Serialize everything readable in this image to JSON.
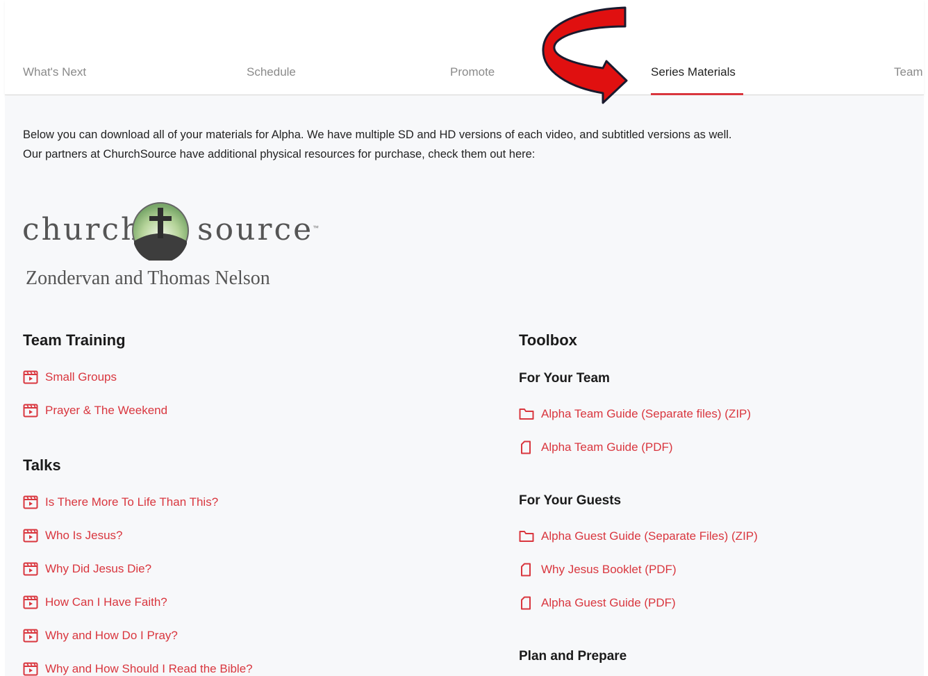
{
  "tabs": [
    {
      "label": "What's Next",
      "active": false
    },
    {
      "label": "Schedule",
      "active": false
    },
    {
      "label": "Promote",
      "active": false
    },
    {
      "label": "Series Materials",
      "active": true
    },
    {
      "label": "Team",
      "active": false
    }
  ],
  "intro": {
    "line1": "Below you can download all of your materials for Alpha. We have multiple SD and HD versions of each video, and subtitled versions as well.",
    "line2": "Our partners at ChurchSource have additional physical resources for purchase, check them out here:"
  },
  "logo": {
    "word_left": "church",
    "word_right": "source",
    "trademark": "™",
    "subtitle": "Zondervan and Thomas Nelson"
  },
  "team_training": {
    "heading": "Team Training",
    "items": [
      {
        "label": "Small Groups",
        "icon": "video-icon"
      },
      {
        "label": "Prayer & The Weekend",
        "icon": "video-icon"
      }
    ]
  },
  "talks": {
    "heading": "Talks",
    "items": [
      {
        "label": "Is There More To Life Than This?",
        "icon": "video-icon"
      },
      {
        "label": "Who Is Jesus?",
        "icon": "video-icon"
      },
      {
        "label": "Why Did Jesus Die?",
        "icon": "video-icon"
      },
      {
        "label": "How Can I Have Faith?",
        "icon": "video-icon"
      },
      {
        "label": "Why and How Do I Pray?",
        "icon": "video-icon"
      },
      {
        "label": "Why and How Should I Read the Bible?",
        "icon": "video-icon"
      }
    ]
  },
  "toolbox": {
    "heading": "Toolbox",
    "for_team": {
      "heading": "For Your Team",
      "items": [
        {
          "label": "Alpha Team Guide (Separate files) (ZIP)",
          "icon": "folder-icon"
        },
        {
          "label": "Alpha Team Guide (PDF)",
          "icon": "file-icon"
        }
      ]
    },
    "for_guests": {
      "heading": "For Your Guests",
      "items": [
        {
          "label": "Alpha Guest Guide (Separate Files) (ZIP)",
          "icon": "folder-icon"
        },
        {
          "label": "Why Jesus Booklet (PDF)",
          "icon": "file-icon"
        },
        {
          "label": "Alpha Guest Guide (PDF)",
          "icon": "file-icon"
        }
      ]
    },
    "plan_prepare": {
      "heading": "Plan and Prepare"
    }
  },
  "colors": {
    "accent": "#d9363e",
    "background": "#f7f8fa",
    "annotation_arrow": "#e01010"
  }
}
